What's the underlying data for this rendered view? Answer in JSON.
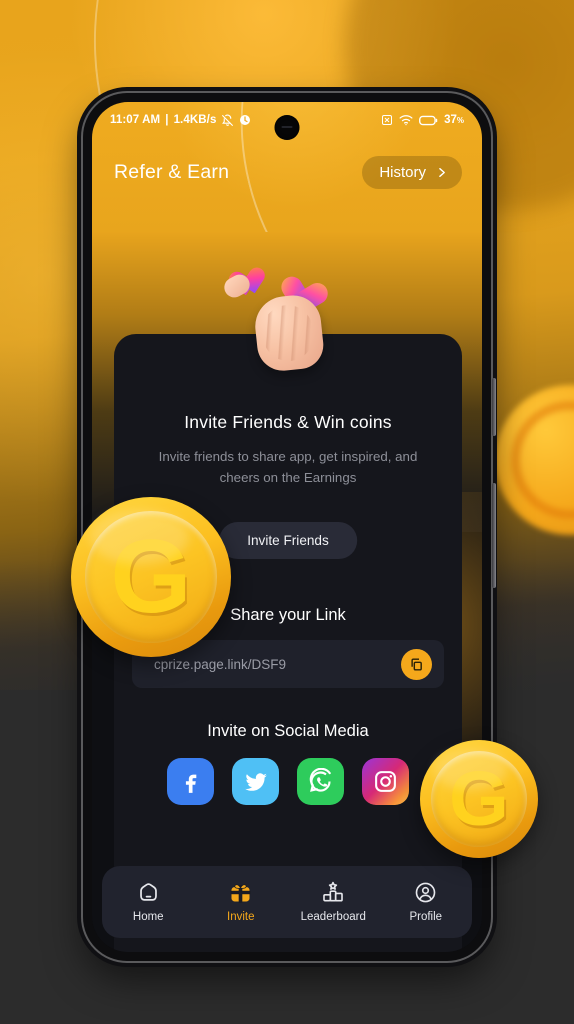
{
  "statusbar": {
    "time": "11:07 AM",
    "separator": "|",
    "network_speed": "1.4KB/s",
    "mute_icon": "bell-muted-icon",
    "alarm_icon": "alarm-badge-icon",
    "nosim_icon": "no-sim-icon",
    "wifi_icon": "wifi-icon",
    "battery_icon": "battery-icon",
    "battery_level": "37",
    "battery_unit": "%"
  },
  "header": {
    "title": "Refer & Earn",
    "history_label": "History",
    "history_chevron": "chevron-right-icon"
  },
  "card": {
    "hero_emoji": "finger-heart-hand-emoji",
    "title": "Invite Friends & Win coins",
    "subtitle": "Invite friends to share app, get inspired, and cheers on the Earnings",
    "invite_button": "Invite Friends"
  },
  "share": {
    "title": "Share your Link",
    "link": "cprize.page.link/DSF9",
    "copy_icon": "copy-icon"
  },
  "social": {
    "title": "Invite on Social Media",
    "items": [
      {
        "name": "facebook",
        "icon": "facebook-icon",
        "color": "#3b7ef0"
      },
      {
        "name": "twitter",
        "icon": "twitter-icon",
        "color": "#4fc0f5"
      },
      {
        "name": "whatsapp",
        "icon": "whatsapp-icon",
        "color": "#2ecc5c"
      },
      {
        "name": "instagram",
        "icon": "instagram-icon",
        "color": "#d62976"
      }
    ]
  },
  "bottom_nav": {
    "active": "Invite",
    "items": [
      {
        "label": "Home",
        "icon": "home-icon"
      },
      {
        "label": "Invite",
        "icon": "gift-icon"
      },
      {
        "label": "Leaderboard",
        "icon": "podium-icon"
      },
      {
        "label": "Profile",
        "icon": "person-circle-icon"
      }
    ]
  },
  "decor": {
    "coin_left_letter": "G",
    "coin_right_letter": "G"
  },
  "colors": {
    "accent_orange": "#f5a81b",
    "header_orange": "#eca81e",
    "card_dark": "#15161c",
    "nav_dark": "#21232e",
    "poster_bg": "#2c2c2c"
  }
}
